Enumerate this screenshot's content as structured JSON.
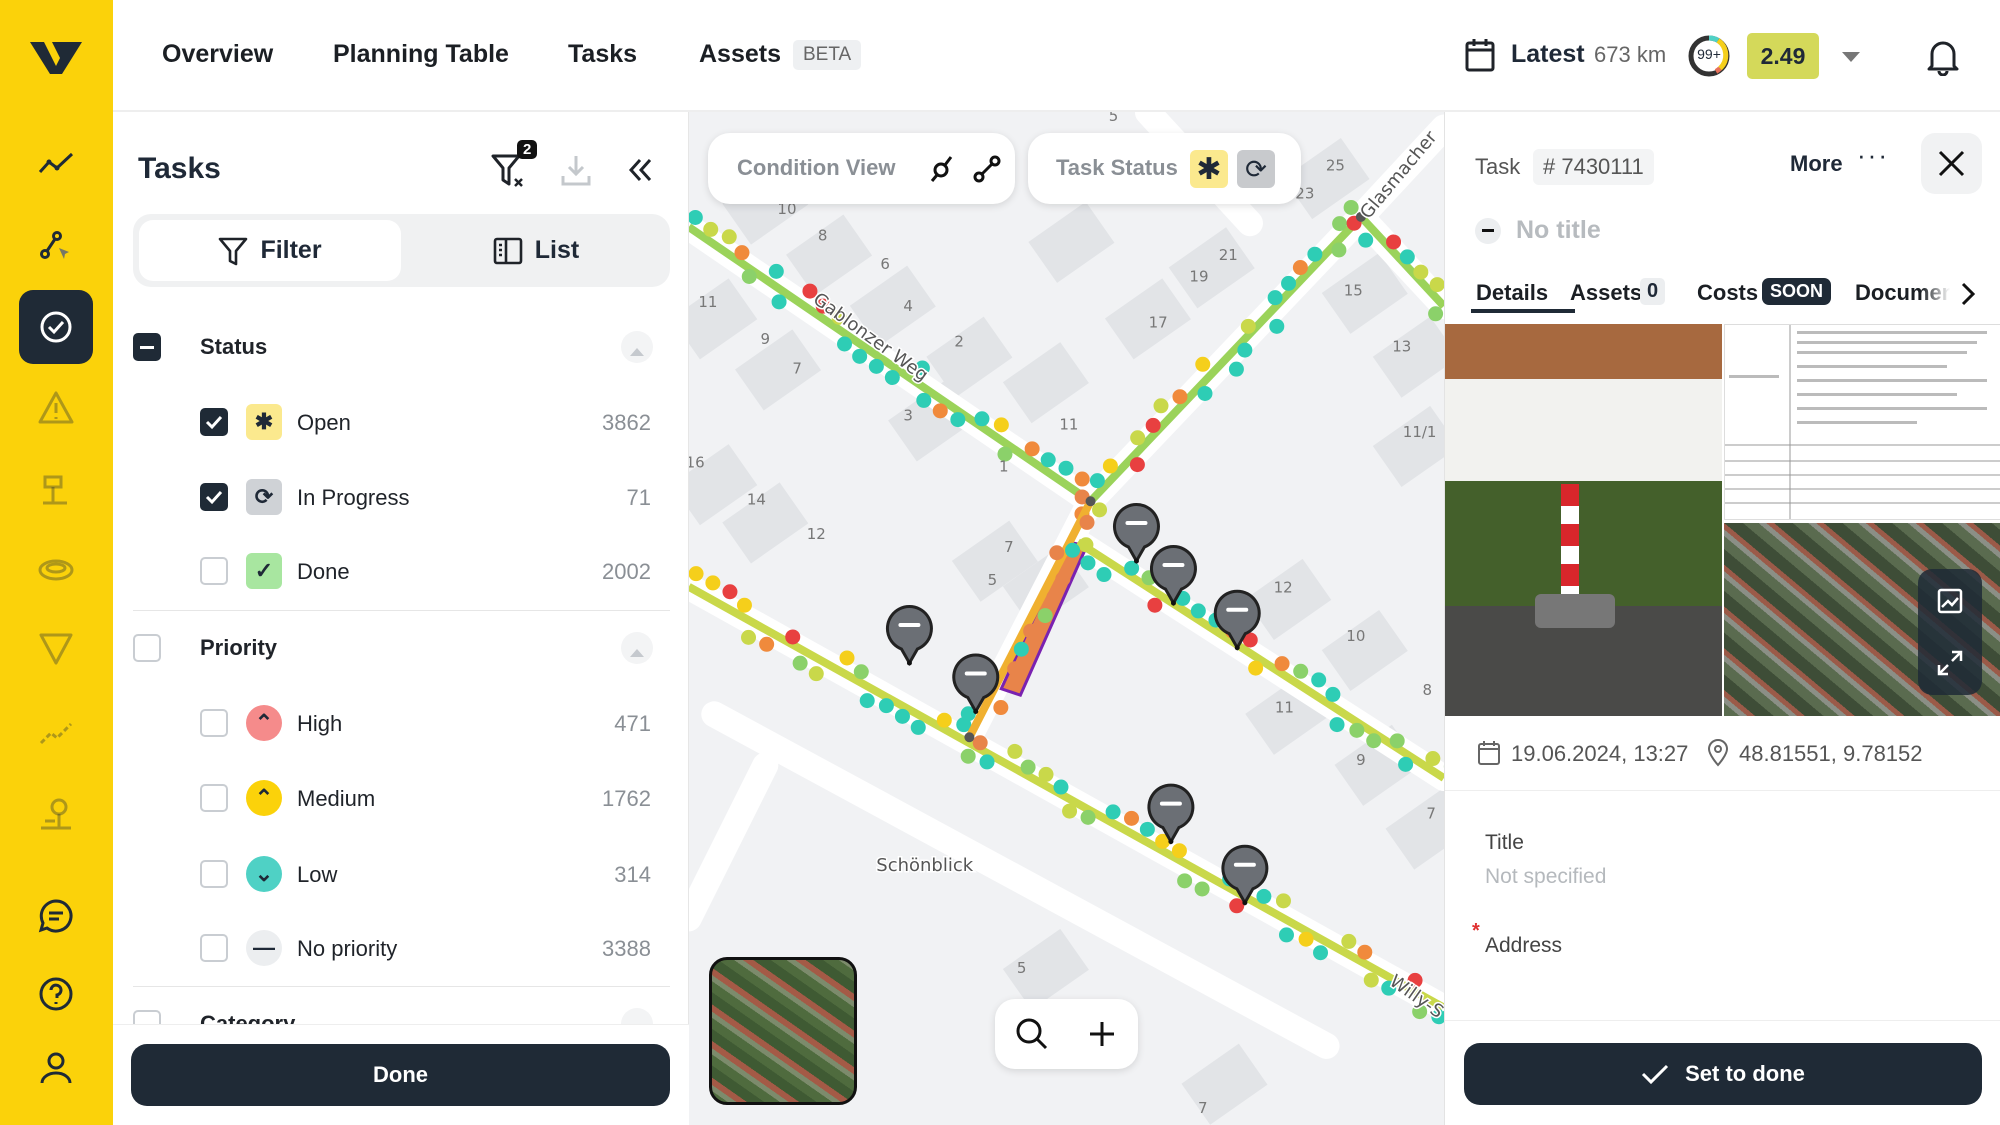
{
  "nav": {
    "items": [
      "Overview",
      "Planning Table",
      "Tasks",
      "Assets"
    ],
    "beta": "BETA"
  },
  "header": {
    "date_label": "Latest",
    "distance": "673 km",
    "badge": "99+",
    "score": "2.49",
    "score_color": "#d4d95a",
    "accent": "#fbd20a"
  },
  "rail": {
    "icons": [
      "analytics-icon",
      "route-select-icon",
      "tasks-icon",
      "warning-icon",
      "sign-icon",
      "manhole-icon",
      "marking-icon",
      "route-icon",
      "tree-icon",
      "chat-icon",
      "help-icon",
      "user-icon"
    ],
    "active": 2
  },
  "tasks": {
    "title": "Tasks",
    "filter_count": "2",
    "seg": {
      "filter": "Filter",
      "list": "List"
    },
    "status": {
      "label": "Status",
      "items": [
        {
          "label": "Open",
          "count": "3862",
          "checked": true,
          "color": "#fbe98e"
        },
        {
          "label": "In Progress",
          "count": "71",
          "checked": true,
          "color": "#cfd2d6"
        },
        {
          "label": "Done",
          "count": "2002",
          "checked": false,
          "color": "#a8e6a0"
        }
      ]
    },
    "priority": {
      "label": "Priority",
      "items": [
        {
          "label": "High",
          "count": "471",
          "color": "#f58b8b"
        },
        {
          "label": "Medium",
          "count": "1762",
          "color": "#fbd20a"
        },
        {
          "label": "Low",
          "count": "314",
          "color": "#4fd1c5"
        },
        {
          "label": "No priority",
          "count": "3388",
          "color": "#eceef0"
        }
      ]
    },
    "category": {
      "label": "Category"
    },
    "done_button": "Done"
  },
  "map": {
    "condition_view": "Condition View",
    "task_status": "Task Status",
    "streets": [
      "Gablonzer Weg",
      "Glasmacher",
      "Schönblick",
      "Willy-S"
    ],
    "house_numbers": [
      "10",
      "8",
      "6",
      "4",
      "2",
      "11",
      "9",
      "7",
      "3",
      "1",
      "11",
      "16",
      "14",
      "12",
      "7",
      "5",
      "17",
      "19",
      "21",
      "23",
      "25",
      "15",
      "13",
      "11/1",
      "12",
      "10",
      "11",
      "9",
      "8",
      "7",
      "5",
      "7",
      "5"
    ],
    "condition_colors": [
      "#2ecdb5",
      "#2ecdb5",
      "#2ecdb5",
      "#8bd16a",
      "#c9d84a",
      "#f5cf1b",
      "#f08a3c",
      "#e84040"
    ]
  },
  "detail": {
    "task_label": "Task",
    "task_id": "# 7430111",
    "more": "More",
    "no_title": "No title",
    "tabs": [
      "Details",
      "Assets",
      "Costs",
      "Documen"
    ],
    "assets_count": "0",
    "costs_badge": "SOON",
    "date": "19.06.2024, 13:27",
    "coords": "48.81551, 9.78152",
    "title_label": "Title",
    "title_value": "Not specified",
    "address_label": "Address",
    "required_mark": "*",
    "set_done": "Set to done"
  }
}
